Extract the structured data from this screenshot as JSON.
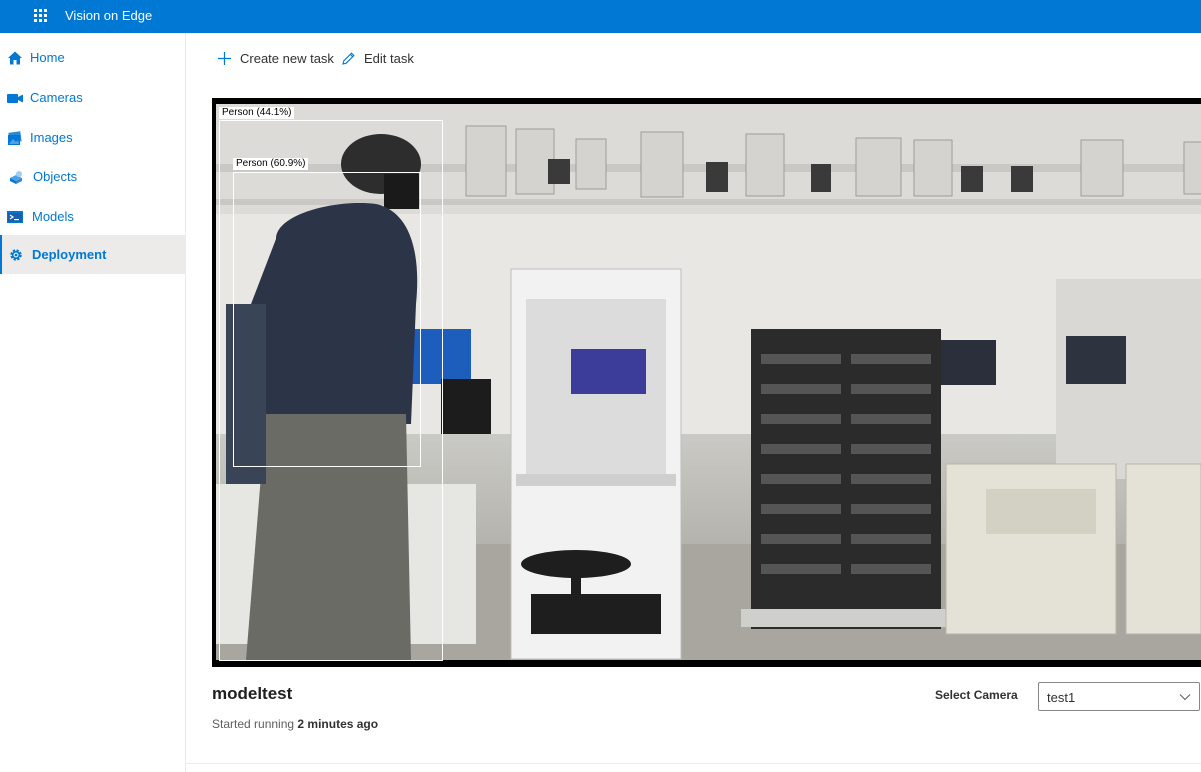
{
  "header": {
    "app_title": "Vision on Edge"
  },
  "sidebar": {
    "items": [
      {
        "label": "Home",
        "icon": "home-icon",
        "selected": false
      },
      {
        "label": "Cameras",
        "icon": "camera-icon",
        "selected": false
      },
      {
        "label": "Images",
        "icon": "images-icon",
        "selected": false
      },
      {
        "label": "Objects",
        "icon": "objects-icon",
        "selected": false
      },
      {
        "label": "Models",
        "icon": "models-icon",
        "selected": false
      },
      {
        "label": "Deployment",
        "icon": "deployment-gear-icon",
        "selected": true
      }
    ]
  },
  "commands": {
    "create_label": "Create new task",
    "edit_label": "Edit task"
  },
  "video": {
    "detections": [
      {
        "label": "Person (44.1%)"
      },
      {
        "label": "Person (60.9%)"
      }
    ]
  },
  "task": {
    "name": "modeltest",
    "status_prefix": "Started running",
    "status_time": "2 minutes ago"
  },
  "camera_select": {
    "label": "Select Camera",
    "value": "test1"
  },
  "colors": {
    "accent": "#0078d4",
    "selected_bg": "#edebe9"
  }
}
